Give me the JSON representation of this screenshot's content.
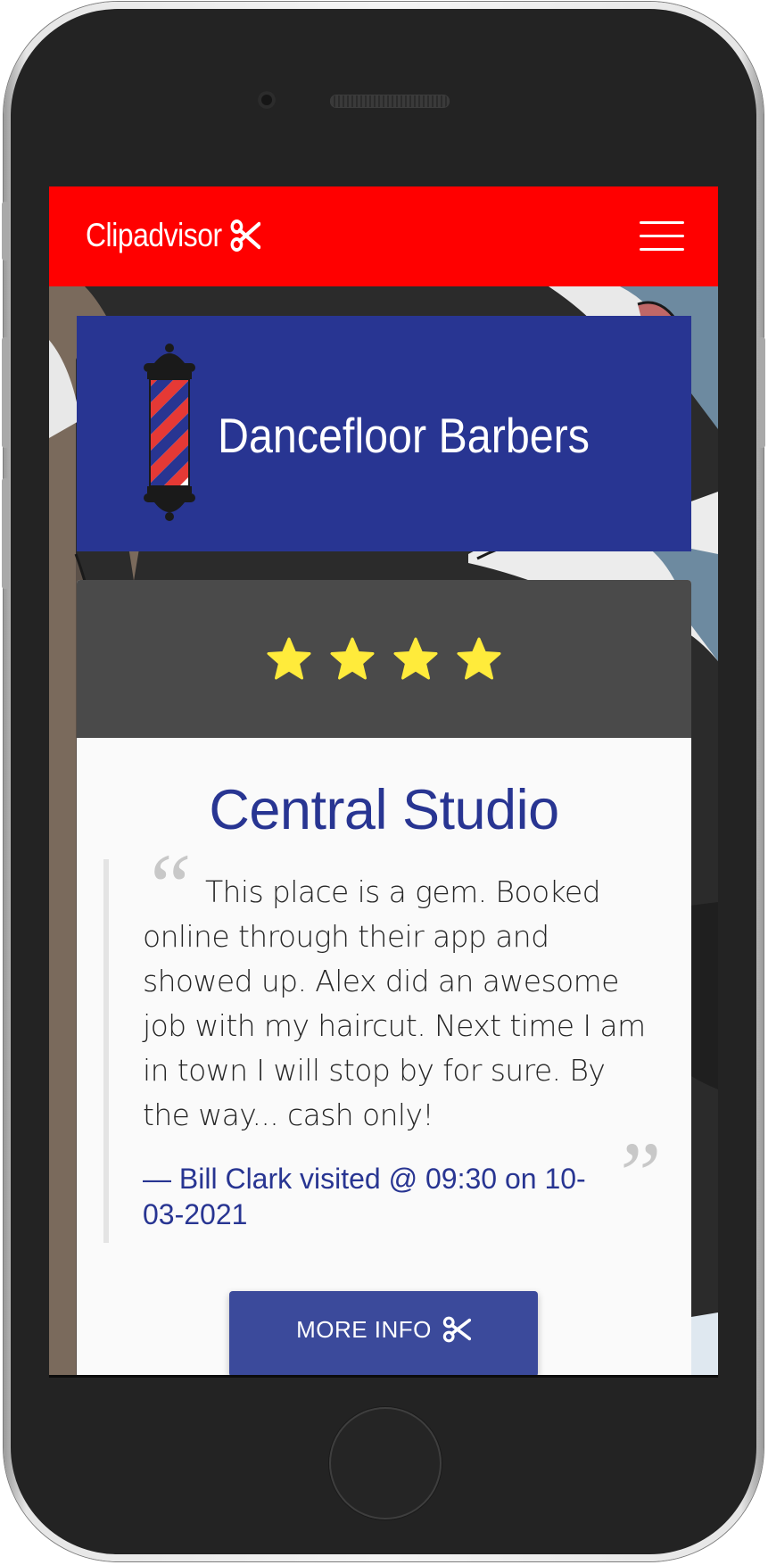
{
  "navbar": {
    "brand": "Clipadvisor",
    "brand_icon": "scissors-icon",
    "menu_icon": "hamburger-menu-icon",
    "background_color": "#ff0000"
  },
  "shop": {
    "name": "Dancefloor Barbers",
    "icon": "barber-pole-icon",
    "background_color": "#283592"
  },
  "review": {
    "rating": 4,
    "rating_max": 4,
    "star_color": "#ffeb3b",
    "location": "Central Studio",
    "quote": "This place is a gem. Booked online through their app and showed up. Alex did an awesome job with my haircut. Next time I am in town I will stop by for sure. By the way... cash only!",
    "attribution": "— Bill Clark visited @ 09:30 on 10-03-2021",
    "accent_color": "#283592"
  },
  "actions": {
    "more_info_label": "MORE INFO",
    "more_info_icon": "scissors-icon"
  }
}
